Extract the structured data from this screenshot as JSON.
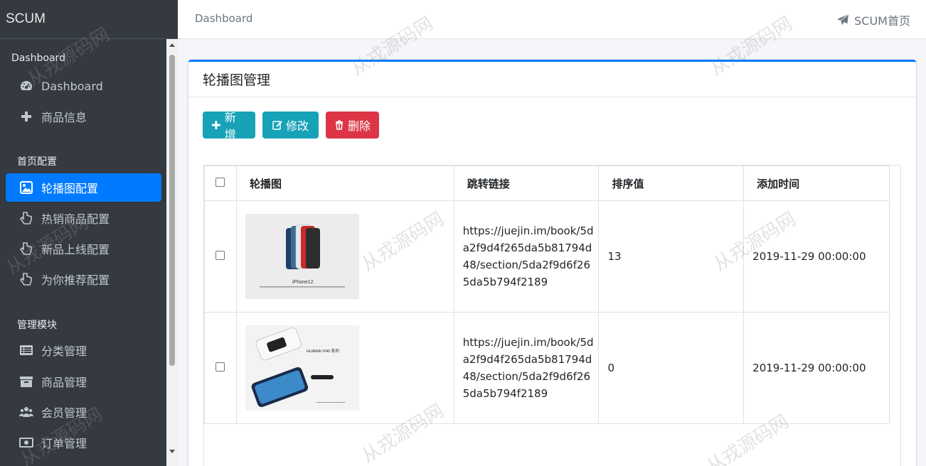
{
  "brand": "SCUM",
  "breadcrumb": "Dashboard",
  "header_link": "SCUM首页",
  "sidebar": {
    "sections": [
      {
        "header": "Dashboard",
        "items": [
          {
            "label": "Dashboard",
            "icon": "dashboard-icon"
          },
          {
            "label": "商品信息",
            "icon": "plus-icon"
          }
        ]
      },
      {
        "header": "首页配置",
        "items": [
          {
            "label": "轮播图配置",
            "icon": "image-icon",
            "active": true
          },
          {
            "label": "热销商品配置",
            "icon": "hand-pointer-icon"
          },
          {
            "label": "新品上线配置",
            "icon": "hand-pointer-icon"
          },
          {
            "label": "为你推荐配置",
            "icon": "hand-pointer-icon"
          }
        ]
      },
      {
        "header": "管理模块",
        "items": [
          {
            "label": "分类管理",
            "icon": "list-alt-icon"
          },
          {
            "label": "商品管理",
            "icon": "archive-icon"
          },
          {
            "label": "会员管理",
            "icon": "users-icon"
          },
          {
            "label": "订单管理",
            "icon": "money-bill-icon"
          }
        ]
      }
    ]
  },
  "card": {
    "title": "轮播图管理",
    "buttons": {
      "add": "新增",
      "edit": "修改",
      "delete": "删除"
    }
  },
  "table": {
    "columns": [
      "轮播图",
      "跳转链接",
      "排序值",
      "添加时间"
    ],
    "rows": [
      {
        "image": "iPhone 12 banner",
        "image_caption": "iPhone12",
        "link": "https://juejin.im/book/5da2f9d4f265da5b81794d48/section/5da2f9d6f265da5b794f2189",
        "order": "13",
        "added": "2019-11-29 00:00:00"
      },
      {
        "image": "HUAWEI P40 banner",
        "image_caption": "HUAWEI P40 系列",
        "link": "https://juejin.im/book/5da2f9d4f265da5b81794d48/section/5da2f9d6f265da5b794f2189",
        "order": "0",
        "added": "2019-11-29 00:00:00"
      }
    ]
  },
  "watermark": "从戎源码网",
  "colors": {
    "sidebar_bg": "#343a40",
    "active": "#007bff",
    "info": "#17a2b8",
    "danger": "#dc3545"
  }
}
